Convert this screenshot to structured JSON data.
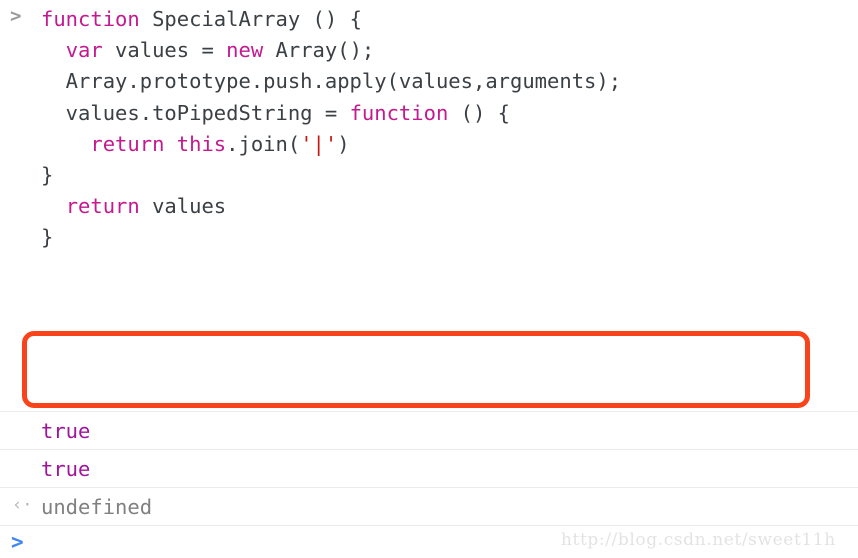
{
  "console": {
    "input_prompt_icon": ">",
    "bottom_prompt_icon": ">",
    "code_lines": [
      [
        {
          "t": "function",
          "c": "kw"
        },
        {
          "t": " SpecialArray () {",
          "c": "pl"
        }
      ],
      [
        {
          "t": "  ",
          "c": "pl"
        },
        {
          "t": "var",
          "c": "kw"
        },
        {
          "t": " values = ",
          "c": "pl"
        },
        {
          "t": "new",
          "c": "kw"
        },
        {
          "t": " Array();",
          "c": "pl"
        }
      ],
      [
        {
          "t": "  Array.prototype.push.apply(values,arguments);",
          "c": "pl"
        }
      ],
      [
        {
          "t": "  values.toPipedString = ",
          "c": "pl"
        },
        {
          "t": "function",
          "c": "kw"
        },
        {
          "t": " () {",
          "c": "pl"
        }
      ],
      [
        {
          "t": "    ",
          "c": "pl"
        },
        {
          "t": "return",
          "c": "kw"
        },
        {
          "t": " ",
          "c": "pl"
        },
        {
          "t": "this",
          "c": "kw"
        },
        {
          "t": ".join(",
          "c": "pl"
        },
        {
          "t": "'|'",
          "c": "str"
        },
        {
          "t": ")",
          "c": "pl"
        }
      ],
      [
        {
          "t": "}",
          "c": "pl"
        }
      ],
      [
        {
          "t": "  ",
          "c": "pl"
        },
        {
          "t": "return",
          "c": "kw"
        },
        {
          "t": " values",
          "c": "pl"
        }
      ],
      [
        {
          "t": "}",
          "c": "pl"
        }
      ],
      [
        {
          "t": "",
          "c": "pl"
        }
      ],
      [
        {
          "t": "",
          "c": "pl"
        }
      ],
      [
        {
          "t": "",
          "c": "pl"
        }
      ],
      [
        {
          "t": "",
          "c": "pl"
        }
      ],
      [
        {
          "t": "",
          "c": "pl"
        }
      ],
      [
        {
          "t": "",
          "c": "pl"
        }
      ]
    ],
    "code_lines_rest": [
      [
        {
          "t": "",
          "c": "pl"
        }
      ]
    ],
    "output_rows": [
      {
        "arrow": "",
        "value": "true",
        "kind": "val-bool"
      },
      {
        "arrow": "",
        "value": "true",
        "kind": "val-bool"
      },
      {
        "arrow": "‹·",
        "value": "undefined",
        "kind": "val-undef"
      }
    ]
  },
  "annotation": {
    "color": "#f9441b",
    "shape": "rounded-rectangle"
  },
  "watermark": {
    "text": "http://blog.csdn.net/sweet11h"
  },
  "colors": {
    "keyword": "#c41a8f",
    "string": "#c41a16",
    "comment": "#007400",
    "plain": "#3b4045",
    "boolean_value": "#a0169b",
    "undefined_value": "#808080",
    "prompt_blue": "#4285f4",
    "prompt_gray": "#9a9a9a",
    "separator": "#ececec",
    "background": "#ffffff",
    "annotation": "#f9441b"
  }
}
